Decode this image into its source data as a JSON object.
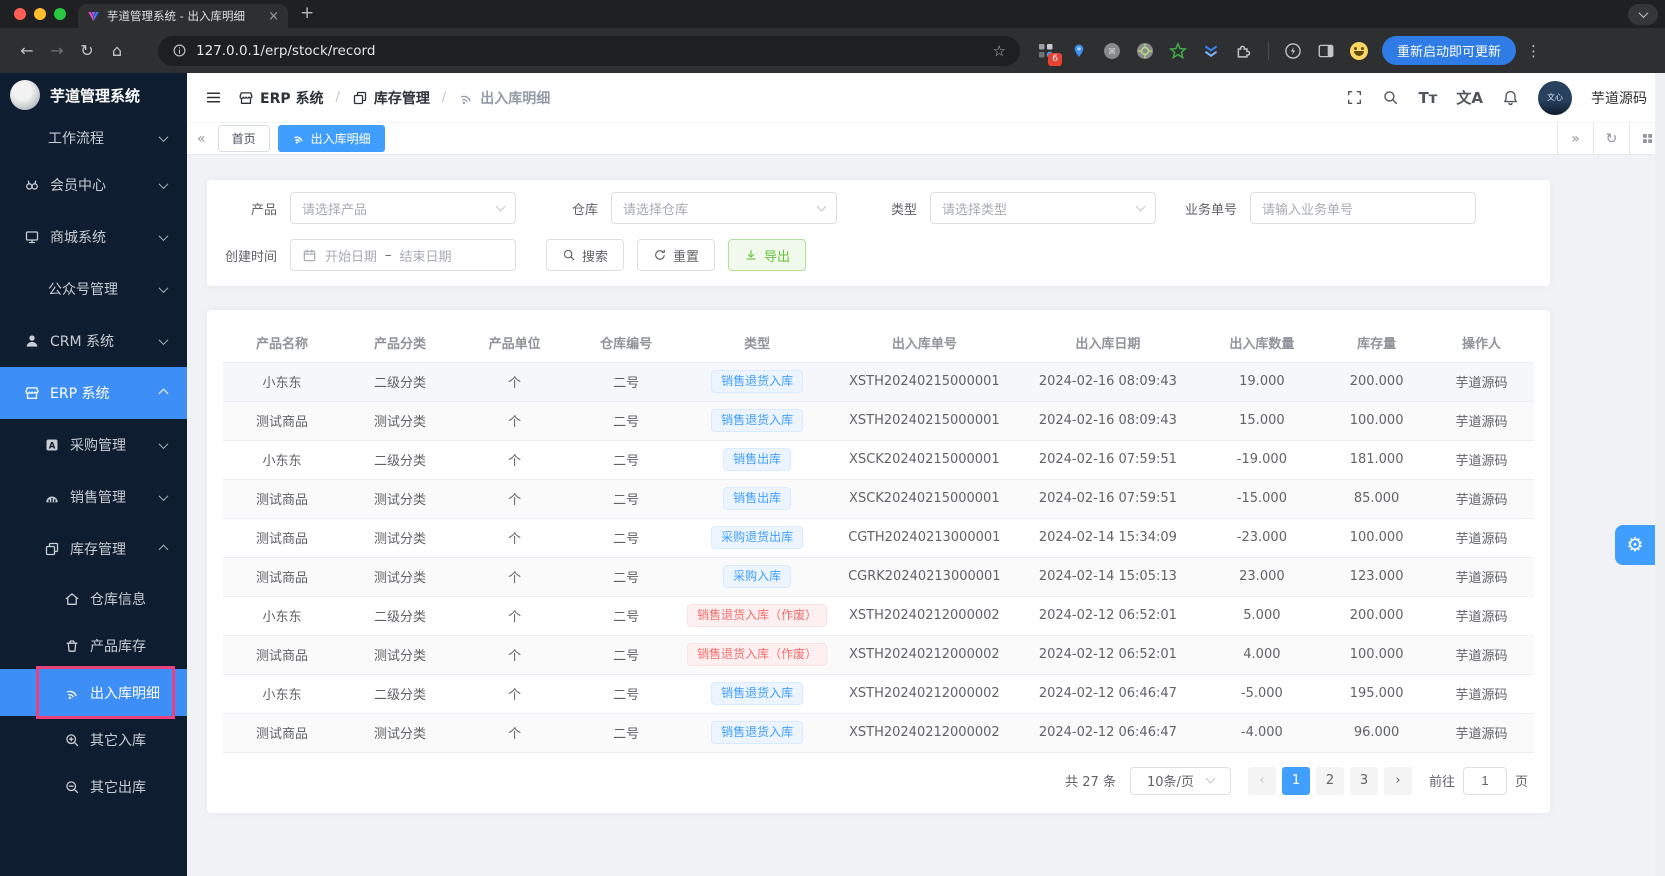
{
  "browser": {
    "tab_title": "芋道管理系统 - 出入库明细",
    "url": "127.0.0.1/erp/stock/record",
    "update_button": "重新启动即可更新",
    "extension_badge": "6"
  },
  "icons_text": {
    "back": "←",
    "forward": "→",
    "reload": "↻",
    "home": "⌂",
    "star": "☆",
    "plus": "+",
    "close": "×",
    "kebab": "⋮",
    "collapse": "«",
    "expand": "»",
    "refresh": "↻",
    "gear": "⚙"
  },
  "sidebar": {
    "brand": "芋道管理系统",
    "items": [
      {
        "label": "工作流程",
        "icon": "",
        "chevron": "down",
        "level": 1
      },
      {
        "label": "会员中心",
        "icon": "member-icon",
        "chevron": "down",
        "level": 1
      },
      {
        "label": "商城系统",
        "icon": "mall-icon",
        "chevron": "down",
        "level": 1
      },
      {
        "label": "公众号管理",
        "icon": "",
        "chevron": "down",
        "level": 1
      },
      {
        "label": "CRM 系统",
        "icon": "user-icon",
        "chevron": "down",
        "level": 1
      },
      {
        "label": "ERP 系统",
        "icon": "store-icon",
        "chevron": "up",
        "level": 1,
        "active": true
      },
      {
        "label": "采购管理",
        "icon": "purchase-icon",
        "chevron": "down",
        "level": 2
      },
      {
        "label": "销售管理",
        "icon": "sales-icon",
        "chevron": "down",
        "level": 2
      },
      {
        "label": "库存管理",
        "icon": "stock-icon",
        "chevron": "up",
        "level": 2
      },
      {
        "label": "仓库信息",
        "icon": "warehouse-icon",
        "level": 3
      },
      {
        "label": "产品库存",
        "icon": "product-stock-icon",
        "level": 3
      },
      {
        "label": "出入库明细",
        "icon": "record-icon",
        "level": 3,
        "active": true,
        "annotated": true
      },
      {
        "label": "其它入库",
        "icon": "stock-in-icon",
        "level": 3
      },
      {
        "label": "其它出库",
        "icon": "stock-out-icon",
        "level": 3
      }
    ]
  },
  "header": {
    "breadcrumb": [
      "ERP 系统",
      "库存管理",
      "出入库明细"
    ],
    "font_icon_text": "Tт",
    "lang_icon_text": "文A",
    "avatar_text": "文心",
    "username": "芋道源码"
  },
  "tabs": [
    {
      "label": "首页",
      "active": false
    },
    {
      "label": "出入库明细",
      "active": true
    }
  ],
  "filters": {
    "product_label": "产品",
    "product_placeholder": "请选择产品",
    "warehouse_label": "仓库",
    "warehouse_placeholder": "请选择仓库",
    "type_label": "类型",
    "type_placeholder": "请选择类型",
    "bizno_label": "业务单号",
    "bizno_placeholder": "请输入业务单号",
    "date_label": "创建时间",
    "date_start": "开始日期",
    "date_separator": "–",
    "date_end": "结束日期",
    "search_button": "搜索",
    "reset_button": "重置",
    "export_button": "导出"
  },
  "table": {
    "columns": [
      "产品名称",
      "产品分类",
      "产品单位",
      "仓库编号",
      "类型",
      "出入库单号",
      "出入库日期",
      "出入库数量",
      "库存量",
      "操作人"
    ],
    "rows": [
      {
        "product": "小东东",
        "category": "二级分类",
        "unit": "个",
        "warehouse": "二号",
        "type": "销售退货入库",
        "type_variant": "blue",
        "order_no": "XSTH20240215000001",
        "date": "2024-02-16 08:09:43",
        "quantity": "19.000",
        "stock": "200.000",
        "operator": "芋道源码"
      },
      {
        "product": "测试商品",
        "category": "测试分类",
        "unit": "个",
        "warehouse": "二号",
        "type": "销售退货入库",
        "type_variant": "blue",
        "order_no": "XSTH20240215000001",
        "date": "2024-02-16 08:09:43",
        "quantity": "15.000",
        "stock": "100.000",
        "operator": "芋道源码"
      },
      {
        "product": "小东东",
        "category": "二级分类",
        "unit": "个",
        "warehouse": "二号",
        "type": "销售出库",
        "type_variant": "blue",
        "order_no": "XSCK20240215000001",
        "date": "2024-02-16 07:59:51",
        "quantity": "-19.000",
        "stock": "181.000",
        "operator": "芋道源码"
      },
      {
        "product": "测试商品",
        "category": "测试分类",
        "unit": "个",
        "warehouse": "二号",
        "type": "销售出库",
        "type_variant": "blue",
        "order_no": "XSCK20240215000001",
        "date": "2024-02-16 07:59:51",
        "quantity": "-15.000",
        "stock": "85.000",
        "operator": "芋道源码"
      },
      {
        "product": "测试商品",
        "category": "测试分类",
        "unit": "个",
        "warehouse": "二号",
        "type": "采购退货出库",
        "type_variant": "blue",
        "order_no": "CGTH20240213000001",
        "date": "2024-02-14 15:34:09",
        "quantity": "-23.000",
        "stock": "100.000",
        "operator": "芋道源码"
      },
      {
        "product": "测试商品",
        "category": "测试分类",
        "unit": "个",
        "warehouse": "二号",
        "type": "采购入库",
        "type_variant": "blue",
        "order_no": "CGRK20240213000001",
        "date": "2024-02-14 15:05:13",
        "quantity": "23.000",
        "stock": "123.000",
        "operator": "芋道源码"
      },
      {
        "product": "小东东",
        "category": "二级分类",
        "unit": "个",
        "warehouse": "二号",
        "type": "销售退货入库（作废）",
        "type_variant": "red",
        "order_no": "XSTH20240212000002",
        "date": "2024-02-12 06:52:01",
        "quantity": "5.000",
        "stock": "200.000",
        "operator": "芋道源码"
      },
      {
        "product": "测试商品",
        "category": "测试分类",
        "unit": "个",
        "warehouse": "二号",
        "type": "销售退货入库（作废）",
        "type_variant": "red",
        "order_no": "XSTH20240212000002",
        "date": "2024-02-12 06:52:01",
        "quantity": "4.000",
        "stock": "100.000",
        "operator": "芋道源码"
      },
      {
        "product": "小东东",
        "category": "二级分类",
        "unit": "个",
        "warehouse": "二号",
        "type": "销售退货入库",
        "type_variant": "blue",
        "order_no": "XSTH20240212000002",
        "date": "2024-02-12 06:46:47",
        "quantity": "-5.000",
        "stock": "195.000",
        "operator": "芋道源码"
      },
      {
        "product": "测试商品",
        "category": "测试分类",
        "unit": "个",
        "warehouse": "二号",
        "type": "销售退货入库",
        "type_variant": "blue",
        "order_no": "XSTH20240212000002",
        "date": "2024-02-12 06:46:47",
        "quantity": "-4.000",
        "stock": "96.000",
        "operator": "芋道源码"
      }
    ]
  },
  "pagination": {
    "total": "共 27 条",
    "page_size": "10条/页",
    "pages": [
      "1",
      "2",
      "3"
    ],
    "active_page": "1",
    "goto_label": "前往",
    "goto_value": "1",
    "page_unit": "页"
  },
  "colors": {
    "accent": "#409eff",
    "sidebar_bg": "#0e1d2f",
    "annotation": "#e8417c",
    "tag_blue": "#409eff",
    "tag_red": "#f56c6c",
    "export_green": "#67c23a",
    "traffic_red": "#ff5f57",
    "traffic_yellow": "#febc2e",
    "traffic_green": "#28c840"
  }
}
